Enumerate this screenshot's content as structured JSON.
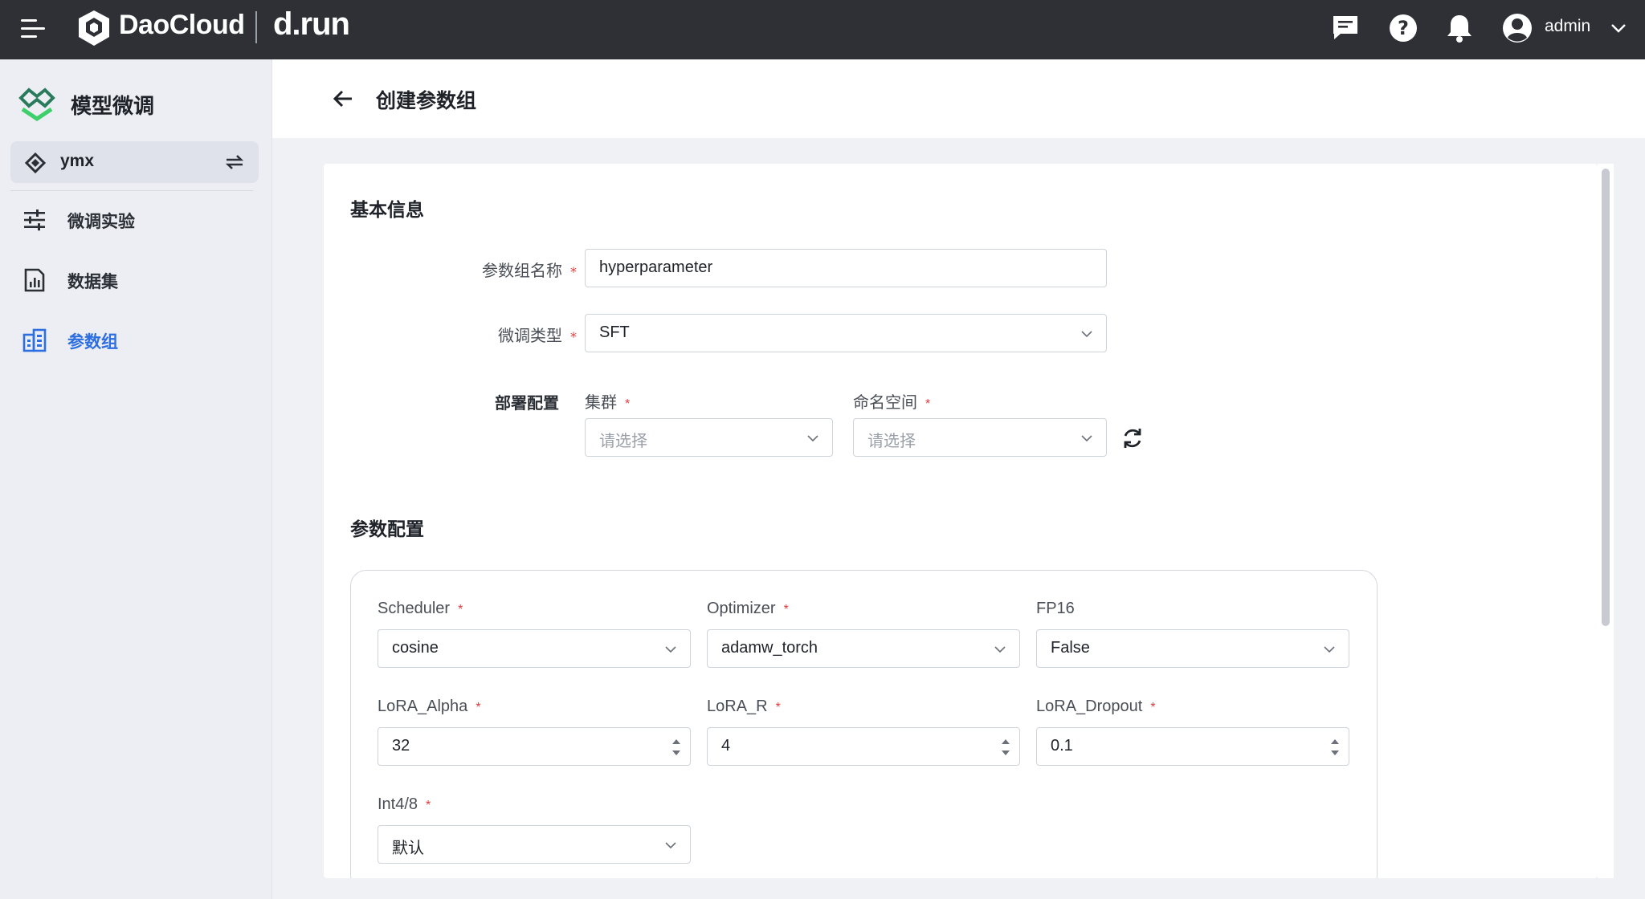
{
  "topbar": {
    "brand": "DaoCloud",
    "product": "d.run",
    "user": "admin"
  },
  "sidebar": {
    "title": "模型微调",
    "workspace": "ymx",
    "items": [
      {
        "label": "微调实验",
        "icon": "sliders-icon"
      },
      {
        "label": "数据集",
        "icon": "dataset-icon"
      },
      {
        "label": "参数组",
        "icon": "param-group-icon",
        "active": true
      }
    ]
  },
  "header": {
    "title": "创建参数组"
  },
  "basic": {
    "section_title": "基本信息",
    "name_label": "参数组名称",
    "name_value": "hyperparameter",
    "type_label": "微调类型",
    "type_value": "SFT",
    "deploy_label": "部署配置",
    "cluster_label": "集群",
    "cluster_placeholder": "请选择",
    "namespace_label": "命名空间",
    "namespace_placeholder": "请选择"
  },
  "params": {
    "section_title": "参数配置",
    "scheduler_label": "Scheduler",
    "scheduler_value": "cosine",
    "optimizer_label": "Optimizer",
    "optimizer_value": "adamw_torch",
    "fp16_label": "FP16",
    "fp16_value": "False",
    "lora_alpha_label": "LoRA_Alpha",
    "lora_alpha_value": "32",
    "lora_r_label": "LoRA_R",
    "lora_r_value": "4",
    "lora_dropout_label": "LoRA_Dropout",
    "lora_dropout_value": "0.1",
    "int_label": "Int4/8",
    "int_value": "默认"
  },
  "required_mark": "*",
  "colors": {
    "topbar": "#2e3036",
    "accent": "#2d6fe0",
    "required": "#e23b3b"
  }
}
